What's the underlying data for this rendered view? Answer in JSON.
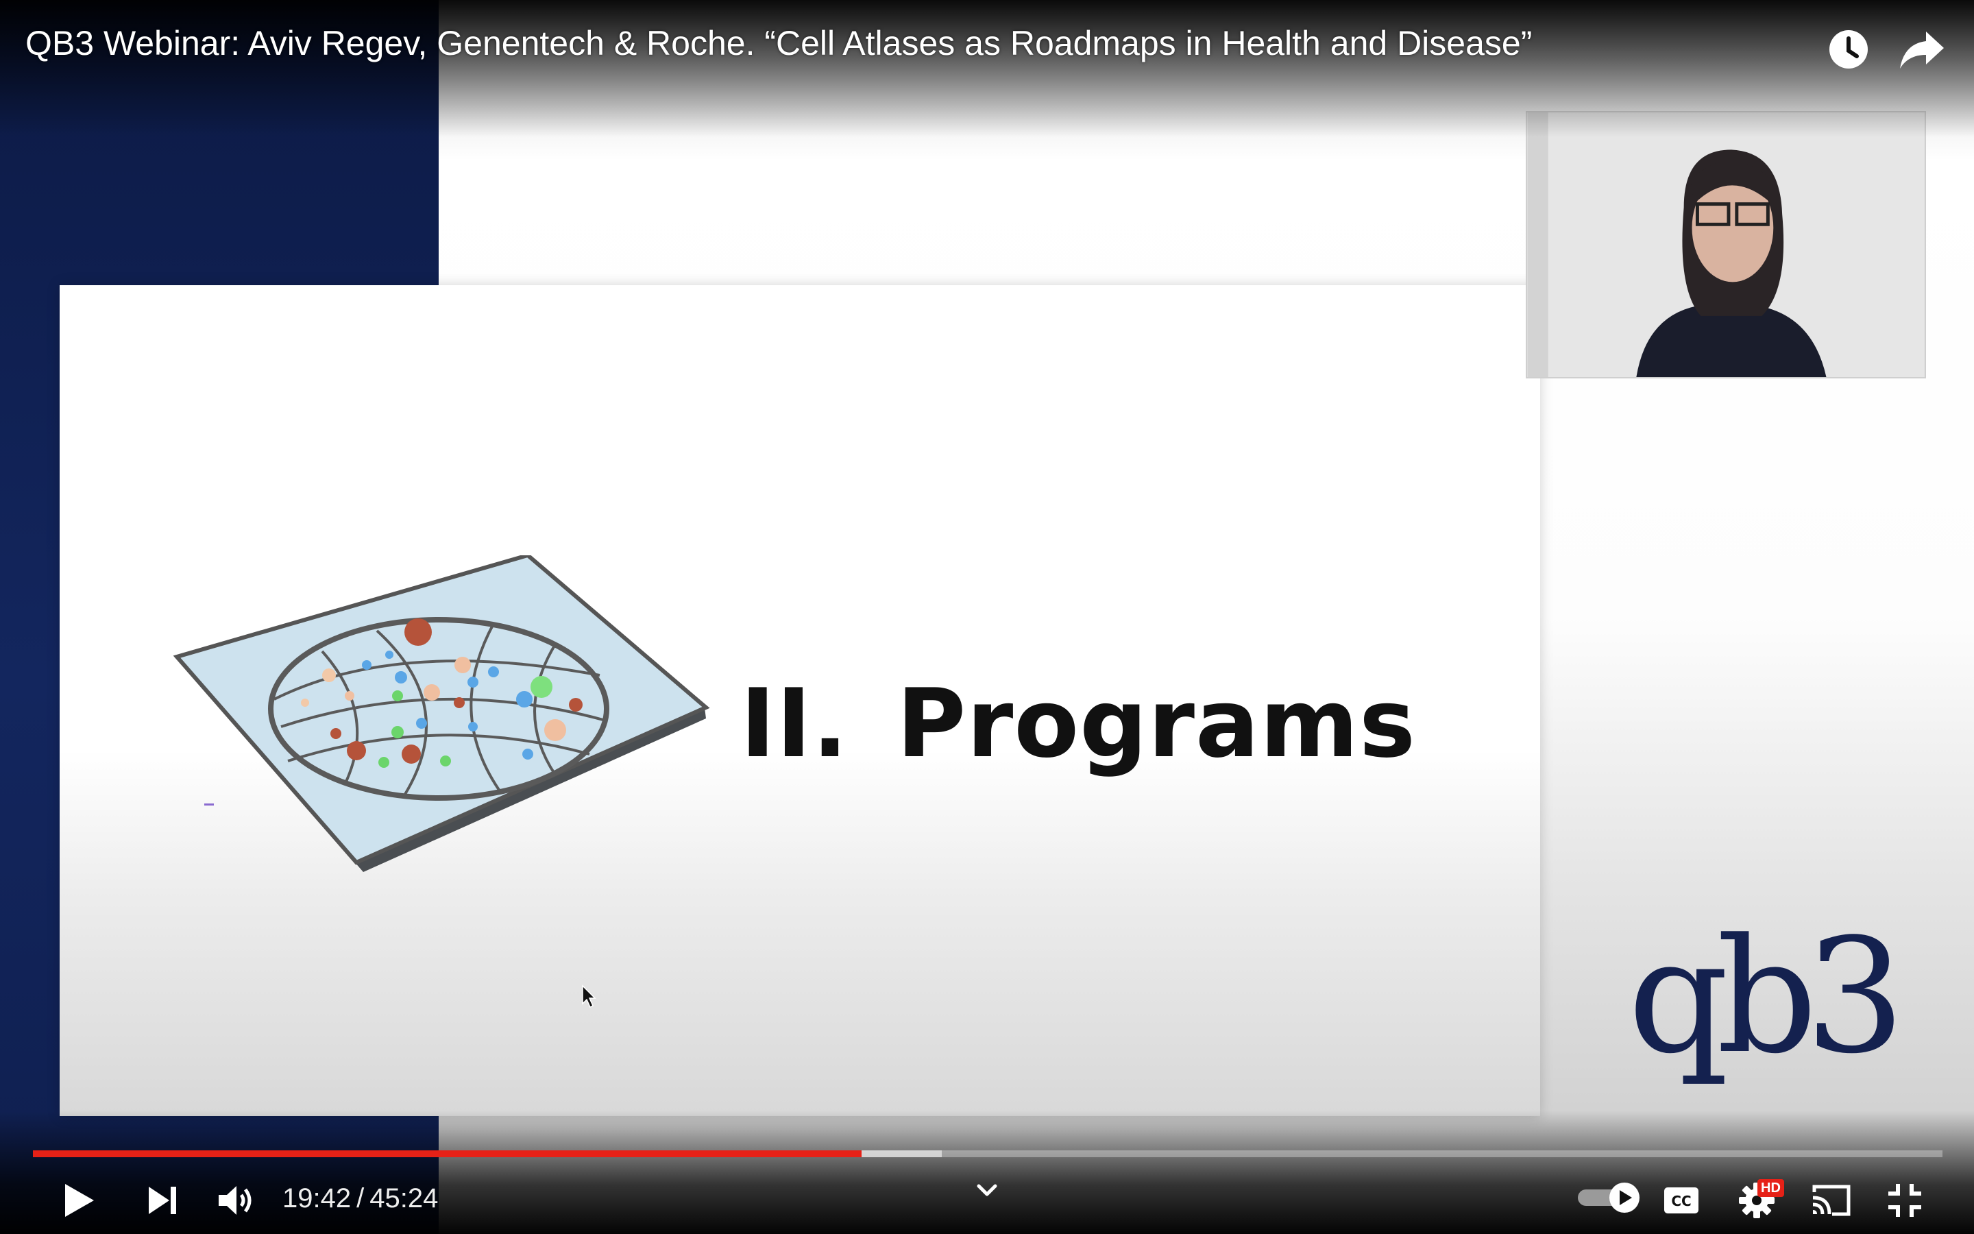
{
  "video": {
    "title": "QB3 Webinar: Aviv Regev, Genentech & Roche. “Cell Atlases as Roadmaps in Health and Disease”"
  },
  "slide": {
    "numeral": "II.",
    "heading": "Programs",
    "logo_text": "qb3",
    "logo_color": "#14214f",
    "background_color": "#0f1f4f"
  },
  "player": {
    "current_time": "19:42",
    "separator": "/",
    "duration": "45:24",
    "progress_fraction": 0.434,
    "buffered_fraction": 0.476,
    "accent_color": "#e62117",
    "hd_badge": "HD",
    "autoplay_on": true
  },
  "icons": {
    "top": [
      "watch-later-icon",
      "share-icon"
    ],
    "controls_left": [
      "play-icon",
      "next-icon",
      "volume-icon"
    ],
    "controls_right": [
      "autoplay-toggle",
      "captions-icon",
      "settings-icon",
      "cast-icon",
      "exit-fullscreen-icon"
    ],
    "center": [
      "chevron-down-icon"
    ]
  }
}
